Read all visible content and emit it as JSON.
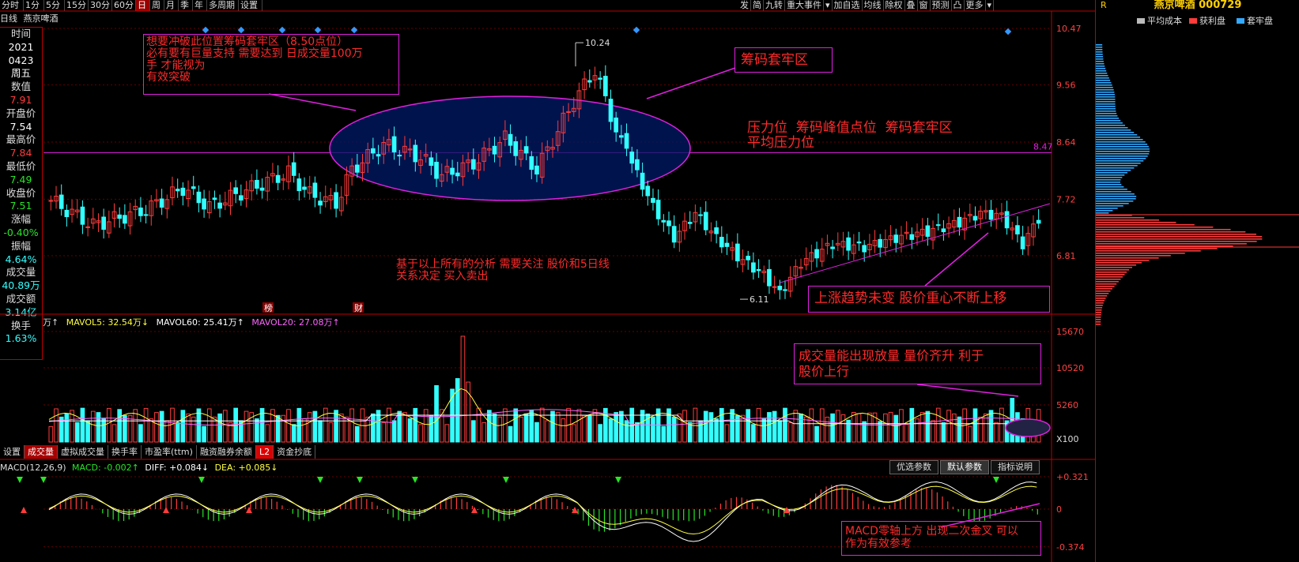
{
  "toolbar": {
    "left": [
      "分时",
      "1分",
      "5分",
      "15分",
      "30分",
      "60分",
      "日",
      "周",
      "月",
      "季",
      "年",
      "多周期",
      "设置"
    ],
    "active": "日",
    "right": [
      "发",
      "简",
      "九转",
      "重大事件",
      "▾",
      "加自选",
      "均线",
      "除权",
      "叠",
      "窗",
      "预测",
      "凸",
      "更多",
      "▾"
    ]
  },
  "stock": {
    "period": "日线",
    "name": "燕京啤酒",
    "header": "燕京啤酒 000729"
  },
  "info_panel": [
    {
      "label": "时间",
      "values": [
        "2021",
        "0423",
        "周五"
      ]
    },
    {
      "label": "数值",
      "value": "7.91",
      "color": "red"
    },
    {
      "label": "开盘价",
      "value": "7.54",
      "color": "white"
    },
    {
      "label": "最高价",
      "value": "7.84",
      "color": "red"
    },
    {
      "label": "最低价",
      "value": "7.49",
      "color": "green"
    },
    {
      "label": "收盘价",
      "value": "7.51",
      "color": "green"
    },
    {
      "label": "涨幅",
      "value": "-0.40%",
      "color": "green"
    },
    {
      "label": "振幅",
      "value": "4.64%",
      "color": "cyan"
    },
    {
      "label": "成交量",
      "value": "40.89万",
      "color": "cyan"
    },
    {
      "label": "成交额",
      "value": "3.14亿",
      "color": "cyan"
    },
    {
      "label": "换手",
      "value": "1.63%",
      "color": "cyan"
    }
  ],
  "price_axis": [
    "10.47",
    "9.56",
    "8.64",
    "7.72",
    "6.81"
  ],
  "pressure_line_label": "8.47",
  "high_marker": "10.24",
  "low_marker": "6.11",
  "event_tags": [
    "榜",
    "财"
  ],
  "volume_header": {
    "prefix": "万↑",
    "mavol5": "MAVOL5: 32.54万↓",
    "mavol60": "MAVOL60: 25.41万↑",
    "mavol20": "MAVOL20: 27.08万↑"
  },
  "volume_axis": [
    "15670",
    "10520",
    "5260",
    "X100"
  ],
  "volume_tabs": [
    "设置",
    "成交量",
    "虚拟成交量",
    "换手率",
    "市盈率(ttm)",
    "融资融券余额",
    "L2",
    "资金抄底"
  ],
  "volume_tab_active": "成交量",
  "macd_header": {
    "name": "MACD(12,26,9)",
    "macd": "MACD: -0.002↑",
    "diff": "DIFF: +0.084↓",
    "dea": "DEA: +0.085↓"
  },
  "macd_axis": [
    "+0.321",
    "0",
    "-0.374"
  ],
  "macd_buttons": [
    "优选参数",
    "默认参数",
    "指标说明"
  ],
  "macd_button_active": "默认参数",
  "chip_legend": [
    "平均成本",
    "获利盘",
    "套牢盘"
  ],
  "chip_R": "R",
  "annotations": {
    "breakout": "想要冲破此位置筹码套牢区（8.50点位）\n必有要有巨量支持 需要达到 日成交量100万\n手 才能视为\n有效突破",
    "trapped_zone": "筹码套牢区",
    "pressure": "压力位  筹码峰值点位  筹码套牢区\n平均压力位",
    "conclusion": "基于以上所有的分析 需要关注 股价和5日线\n关系决定 买入卖出",
    "uptrend": "上涨趋势未变 股价重心不断上移",
    "volume_note": "成交量能出现放量 量价齐升 利于\n股价上行",
    "macd_note": "MACD零轴上方 出现二次金叉 可以\n作为有效参考"
  },
  "colors": {
    "up": "#ff3b3b",
    "down": "#3ff",
    "accent": "#e020e0",
    "text_red": "#ff2a2a",
    "axis": "#b00",
    "title": "#ffd000"
  }
}
